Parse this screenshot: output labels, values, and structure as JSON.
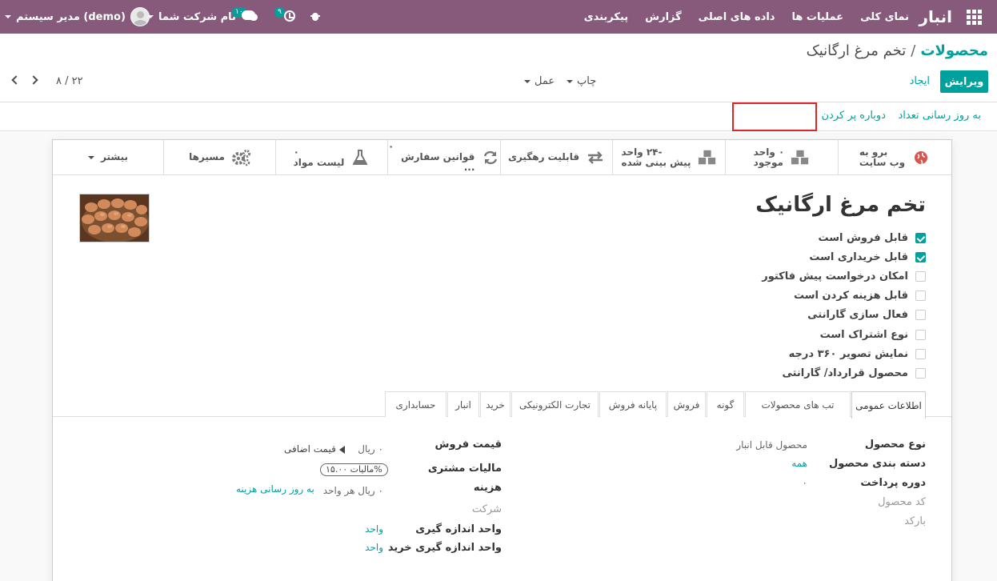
{
  "navbar": {
    "brand": "انبار",
    "menu": [
      "نمای کلی",
      "عملیات ها",
      "داده های اصلی",
      "گزارش",
      "پیکربندی"
    ],
    "user_name": "مدیر سیستم (demo)",
    "company": "نام شرکت شما",
    "chat_badge": "۱۰",
    "activity_badge": "۹"
  },
  "breadcrumb": {
    "parent": "محصولات",
    "separator": "/",
    "current": "تخم مرغ ارگانیک"
  },
  "buttons": {
    "edit": "ویرایش",
    "create": "ایجاد",
    "print": "چاپ",
    "action": "عمل"
  },
  "pager": {
    "text": "۸ / ۲۲"
  },
  "statusbar": {
    "update_qty": "به روز رسانی تعداد",
    "replenish": "دوباره پر کردن"
  },
  "smart_buttons": [
    {
      "value": "برو به",
      "label": "وب سایت",
      "icon": "globe-icon"
    },
    {
      "value": "۰ واحد",
      "label": "موجود",
      "icon": "cubes-icon"
    },
    {
      "value": "-۲۴ واحد",
      "label": "پیش بینی شده",
      "icon": "cubes-icon"
    },
    {
      "value": "",
      "label": "قابلیت رهگیری",
      "icon": "exchange-icon"
    },
    {
      "value": "۰",
      "label": "قوانین سفارش ...",
      "icon": "refresh-icon"
    },
    {
      "value": "۰",
      "label": "لیست مواد",
      "icon": "flask-icon"
    },
    {
      "value": "",
      "label": "مسیرها",
      "icon": "cogs-icon"
    },
    {
      "value": "",
      "label": "بیشتر",
      "icon": "caret-icon"
    }
  ],
  "product": {
    "title": "تخم مرغ ارگانیک",
    "checkboxes": [
      {
        "label": "قابل فروش است",
        "checked": true
      },
      {
        "label": "قابل خریداری است",
        "checked": true
      },
      {
        "label": "امکان درخواست پیش فاکتور",
        "checked": false
      },
      {
        "label": "قابل هزینه کردن است",
        "checked": false
      },
      {
        "label": "فعال سازی گارانتی",
        "checked": false
      },
      {
        "label": "نوع اشتراک است",
        "checked": false
      },
      {
        "label": "نمایش تصویر ۳۶۰ درجه",
        "checked": false
      },
      {
        "label": "محصول قرارداد/ گارانتی",
        "checked": false
      }
    ]
  },
  "tabs": [
    "اطلاعات عمومی",
    "تب های محصولات",
    "گونه",
    "فروش",
    "پایانه فروش",
    "تجارت الکترونیکی",
    "خرید",
    "انبار",
    "حسابداری"
  ],
  "general": {
    "left": {
      "sale_price_label": "قیمت فروش",
      "sale_price_value": "۰ ریال",
      "extra_price": "قیمت اضافی",
      "customer_tax_label": "مالیات مشتری",
      "customer_tax_value": "مالیات ۱۵.۰۰%",
      "cost_label": "هزینه",
      "cost_value": "۰ ریال هر واحد",
      "update_cost": "به روز رسانی هزینه",
      "company_label": "شرکت",
      "uom_label": "واحد اندازه گیری",
      "uom_value": "واحد",
      "purchase_uom_label": "واحد اندازه گیری خرید",
      "purchase_uom_value": "واحد"
    },
    "right": {
      "product_type_label": "نوع محصول",
      "product_type_value": "محصول قابل انبار",
      "category_label": "دسته بندی محصول",
      "category_value": "همه",
      "payment_period_label": "دوره پرداخت",
      "payment_period_value": "۰",
      "product_code_label": "کد محصول",
      "barcode_label": "بارکد"
    }
  },
  "colors": {
    "navbar": "#875a7b",
    "accent": "#00a09d",
    "highlight_box": "#e0242a"
  }
}
